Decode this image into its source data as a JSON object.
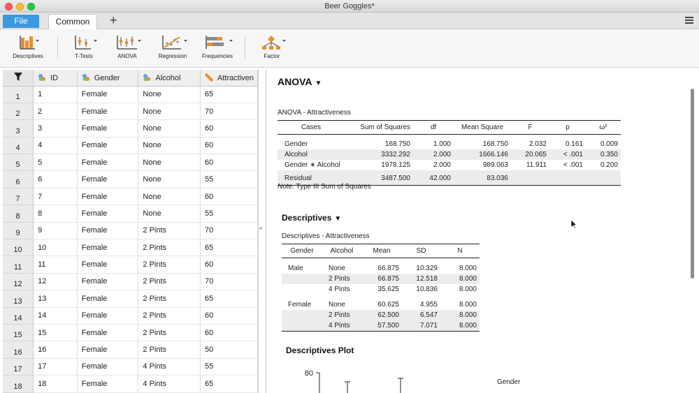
{
  "window": {
    "title": "Beer Goggles*"
  },
  "tabs": {
    "file": "File",
    "common": "Common",
    "add": "+"
  },
  "ribbon": [
    {
      "label": "Descriptives",
      "icon": "descriptives-icon"
    },
    {
      "label": "T-Tests",
      "icon": "ttests-icon"
    },
    {
      "label": "ANOVA",
      "icon": "anova-icon"
    },
    {
      "label": "Regression",
      "icon": "regression-icon"
    },
    {
      "label": "Frequencies",
      "icon": "frequencies-icon"
    },
    {
      "label": "Factor",
      "icon": "factor-icon"
    }
  ],
  "grid": {
    "columns": [
      "ID",
      "Gender",
      "Alcohol",
      "Attractiven"
    ],
    "rows": [
      [
        "1",
        "1",
        "Female",
        "None",
        "65"
      ],
      [
        "2",
        "2",
        "Female",
        "None",
        "70"
      ],
      [
        "3",
        "3",
        "Female",
        "None",
        "60"
      ],
      [
        "4",
        "4",
        "Female",
        "None",
        "60"
      ],
      [
        "5",
        "5",
        "Female",
        "None",
        "60"
      ],
      [
        "6",
        "6",
        "Female",
        "None",
        "55"
      ],
      [
        "7",
        "7",
        "Female",
        "None",
        "60"
      ],
      [
        "8",
        "8",
        "Female",
        "None",
        "55"
      ],
      [
        "9",
        "9",
        "Female",
        "2 Pints",
        "70"
      ],
      [
        "10",
        "10",
        "Female",
        "2 Pints",
        "65"
      ],
      [
        "11",
        "11",
        "Female",
        "2 Pints",
        "60"
      ],
      [
        "12",
        "12",
        "Female",
        "2 Pints",
        "70"
      ],
      [
        "13",
        "13",
        "Female",
        "2 Pints",
        "65"
      ],
      [
        "14",
        "14",
        "Female",
        "2 Pints",
        "60"
      ],
      [
        "15",
        "15",
        "Female",
        "2 Pints",
        "60"
      ],
      [
        "16",
        "16",
        "Female",
        "2 Pints",
        "50"
      ],
      [
        "17",
        "17",
        "Female",
        "4 Pints",
        "55"
      ],
      [
        "18",
        "18",
        "Female",
        "4 Pints",
        "65"
      ]
    ]
  },
  "anova": {
    "heading": "ANOVA",
    "caption": "ANOVA - Attractiveness",
    "headers": [
      "Cases",
      "Sum of Squares",
      "df",
      "Mean Square",
      "F",
      "p",
      "ω²"
    ],
    "rows": [
      [
        "Gender",
        "168.750",
        "1.000",
        "168.750",
        "2.032",
        "0.161",
        "0.009"
      ],
      [
        "Alcohol",
        "3332.292",
        "2.000",
        "1666.146",
        "20.065",
        "< .001",
        "0.350"
      ],
      [
        "Gender ∗ Alcohol",
        "1978.125",
        "2.000",
        "989.063",
        "11.911",
        "< .001",
        "0.200"
      ],
      [
        "Residual",
        "3487.500",
        "42.000",
        "83.036",
        "",
        "",
        ""
      ]
    ],
    "note_label": "Note.",
    "note_text": "Type III Sum of Squares"
  },
  "descriptives": {
    "heading": "Descriptives",
    "caption": "Descriptives - Attractiveness",
    "headers": [
      "Gender",
      "Alcohol",
      "Mean",
      "SD",
      "N"
    ],
    "rows": [
      [
        "Male",
        "None",
        "66.875",
        "10.329",
        "8.000"
      ],
      [
        "",
        "2 Pints",
        "66.875",
        "12.518",
        "8.000"
      ],
      [
        "",
        "4 Pints",
        "35.625",
        "10.836",
        "8.000"
      ],
      [
        "Female",
        "None",
        "60.625",
        "4.955",
        "8.000"
      ],
      [
        "",
        "2 Pints",
        "62.500",
        "6.547",
        "8.000"
      ],
      [
        "",
        "4 Pints",
        "57.500",
        "7.071",
        "8.000"
      ]
    ]
  },
  "plot": {
    "heading": "Descriptives Plot",
    "y_tick": "80",
    "legend_title": "Gender"
  },
  "colors": {
    "file_tab": "#3c98e0",
    "icon_orange": "#e98f2f",
    "icon_gray": "#8a8a8a"
  }
}
